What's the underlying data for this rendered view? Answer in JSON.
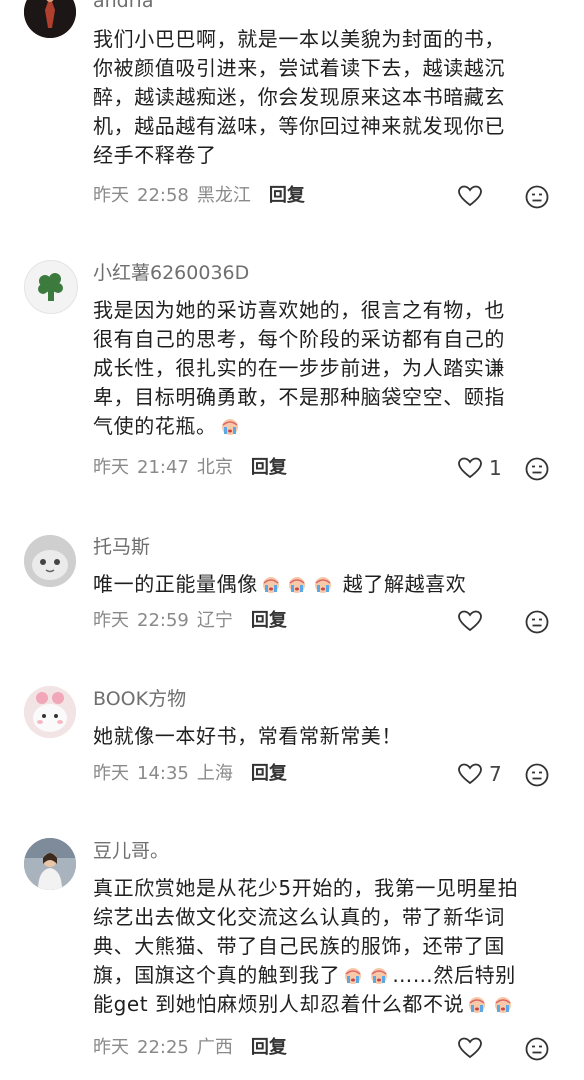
{
  "comments": [
    {
      "name": "andria",
      "text_lines": [
        "我们小巴巴啊，就是一本以美貌为封面的书，",
        "你被颜值吸引进来，尝试着读下去，越读越沉",
        "醉，越读越痴迷，你会发现原来这本书暗藏玄",
        "机，越品越有滋味，等你回过神来就发现你已",
        "经手不释卷了"
      ],
      "day": "昨天",
      "time": "22:58",
      "location": "黑龙江",
      "reply": "回复",
      "likes": ""
    },
    {
      "name": "小红薯6260036D",
      "text_lines": [
        "我是因为她的采访喜欢她的，很言之有物，也",
        "很有自己的思考，每个阶段的采访都有自己的",
        "成长性，很扎实的在一步步前进，为人踏实谦",
        "卑，目标明确勇敢，不是那种脑袋空空、颐指",
        "气使的花瓶。"
      ],
      "day": "昨天",
      "time": "21:47",
      "location": "北京",
      "reply": "回复",
      "likes": "1"
    },
    {
      "name": "托马斯",
      "text_before": "唯一的正能量偶像",
      "text_after": " 越了解越喜欢",
      "day": "昨天",
      "time": "22:59",
      "location": "辽宁",
      "reply": "回复",
      "likes": ""
    },
    {
      "name": "BOOK方物",
      "text_lines": [
        "她就像一本好书，常看常新常美！"
      ],
      "day": "昨天",
      "time": "14:35",
      "location": "上海",
      "reply": "回复",
      "likes": "7"
    },
    {
      "name": "豆儿哥。",
      "text_lines": [
        "真正欣赏她是从花少5开始的，我第一见明星拍",
        "综艺出去做文化交流这么认真的，带了新华词",
        "典、大熊猫、带了自己民族的服饰，还带了国"
      ],
      "line4_before": "旗，国旗这个真的触到我了",
      "line4_after": "……然后特别",
      "line5_before": "能get 到她怕麻烦别人却忍着什么都不说",
      "day": "昨天",
      "time": "22:25",
      "location": "广西",
      "reply": "回复",
      "likes": ""
    }
  ]
}
